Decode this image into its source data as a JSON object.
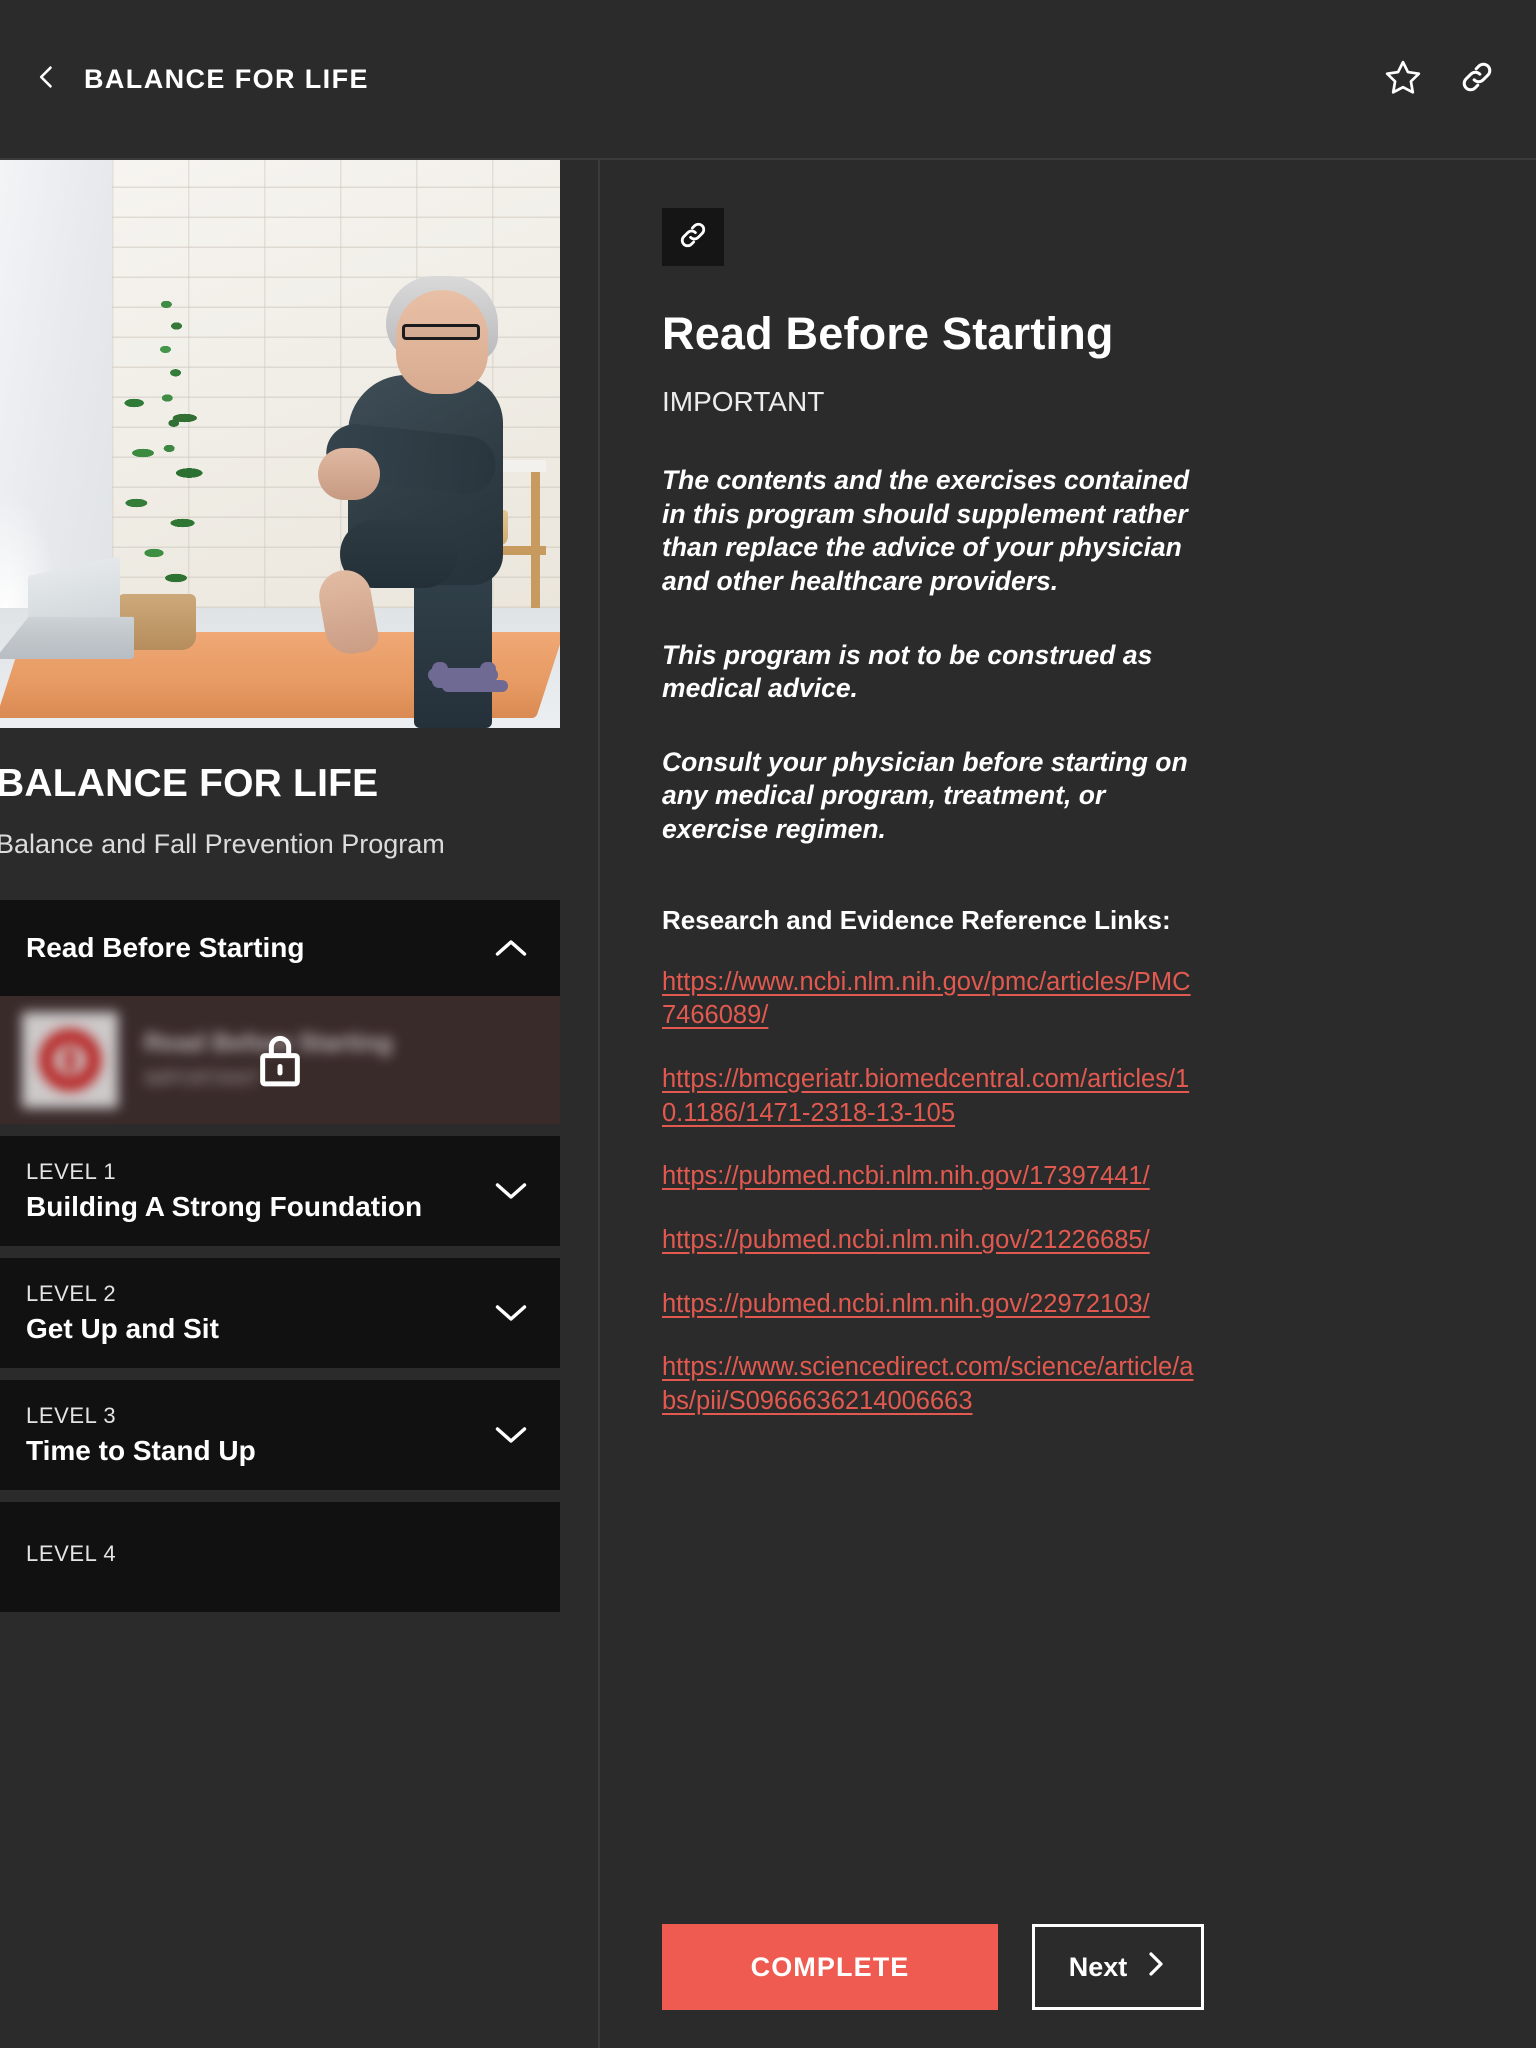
{
  "topbar": {
    "back_icon": "chevron-left-icon",
    "title": "BALANCE FOR LIFE",
    "favorite_icon": "star-icon",
    "share_icon": "link-icon"
  },
  "sidebar": {
    "program_title": "BALANCE FOR LIFE",
    "program_subtitle": "Balance and Fall Prevention Program",
    "sections": [
      {
        "eyebrow": "",
        "title": "Read Before Starting",
        "state": "expanded",
        "chevron": "chevron-up-icon",
        "lessons": [
          {
            "name": "Read Before Starting",
            "subtitle": "IMPORTANT",
            "locked": true,
            "lock_icon": "lock-icon"
          }
        ]
      },
      {
        "eyebrow": "LEVEL 1",
        "title": "Building A Strong Foundation",
        "state": "collapsed",
        "chevron": "chevron-down-icon",
        "lessons": []
      },
      {
        "eyebrow": "LEVEL 2",
        "title": "Get Up and Sit",
        "state": "collapsed",
        "chevron": "chevron-down-icon",
        "lessons": []
      },
      {
        "eyebrow": "LEVEL 3",
        "title": "Time to Stand Up",
        "state": "collapsed",
        "chevron": "chevron-down-icon",
        "lessons": []
      },
      {
        "eyebrow": "LEVEL 4",
        "title": "",
        "state": "collapsed",
        "chevron": "chevron-down-icon",
        "lessons": []
      }
    ]
  },
  "content": {
    "share_icon": "link-icon",
    "title": "Read Before Starting",
    "eyebrow": "IMPORTANT",
    "paragraphs": [
      "The contents and the exercises contained in this program should supplement rather than replace the advice of your physician and other healthcare providers.",
      "This program is not to be construed as medical advice.",
      "Consult your physician before starting on any medical program, treatment, or exercise regimen."
    ],
    "refs_heading": "Research and Evidence Reference Links:",
    "links": [
      "https://www.ncbi.nlm.nih.gov/pmc/articles/PMC7466089/",
      "https://bmcgeriatr.biomedcentral.com/articles/10.1186/1471-2318-13-105",
      "https://pubmed.ncbi.nlm.nih.gov/17397441/",
      "https://pubmed.ncbi.nlm.nih.gov/21226685/",
      "https://pubmed.ncbi.nlm.nih.gov/22972103/",
      "https://www.sciencedirect.com/science/article/abs/pii/S0966636214006663"
    ],
    "complete_label": "COMPLETE",
    "next_label": "Next",
    "next_icon": "chevron-right-icon"
  },
  "colors": {
    "app_background": "#2b2b2b",
    "panel_black": "#111111",
    "accent_red": "#ef5b50",
    "link_red": "#e2594f",
    "locked_row": "#3a2b2b"
  }
}
